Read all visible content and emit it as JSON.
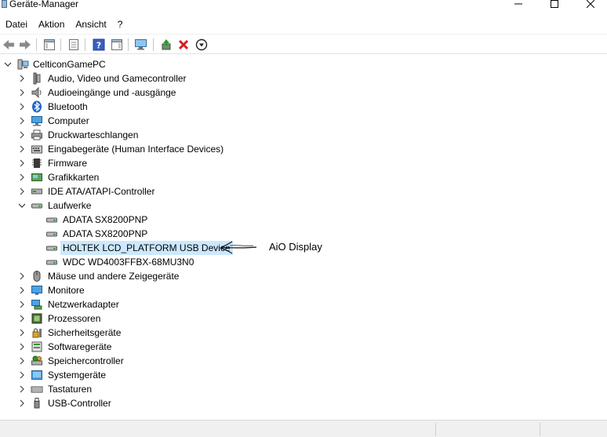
{
  "window": {
    "title": "Geräte-Manager",
    "icon": "device-manager-icon"
  },
  "menu": [
    "Datei",
    "Aktion",
    "Ansicht",
    "?"
  ],
  "toolbar": [
    {
      "name": "back-icon"
    },
    {
      "name": "forward-icon"
    },
    {
      "name": "show-hide-console-tree-icon"
    },
    {
      "name": "properties-icon"
    },
    {
      "name": "help-icon"
    },
    {
      "name": "action-pane-icon"
    },
    {
      "name": "scan-hardware-icon"
    },
    {
      "name": "update-driver-icon"
    },
    {
      "name": "uninstall-device-icon"
    },
    {
      "name": "disable-device-icon"
    }
  ],
  "tree": {
    "root": "CelticonGamePC",
    "categories": [
      {
        "label": "Audio, Video und Gamecontroller",
        "icon": "audio-icon"
      },
      {
        "label": "Audioeingänge und -ausgänge",
        "icon": "speaker-icon"
      },
      {
        "label": "Bluetooth",
        "icon": "bluetooth-icon"
      },
      {
        "label": "Computer",
        "icon": "computer-icon"
      },
      {
        "label": "Druckwarteschlangen",
        "icon": "printer-icon"
      },
      {
        "label": "Eingabegeräte (Human Interface Devices)",
        "icon": "hid-icon"
      },
      {
        "label": "Firmware",
        "icon": "firmware-icon"
      },
      {
        "label": "Grafikkarten",
        "icon": "display-adapter-icon"
      },
      {
        "label": "IDE ATA/ATAPI-Controller",
        "icon": "ide-controller-icon"
      },
      {
        "label": "Laufwerke",
        "icon": "disk-drive-icon",
        "expanded": true
      },
      {
        "label": "Mäuse und andere Zeigegeräte",
        "icon": "mouse-icon"
      },
      {
        "label": "Monitore",
        "icon": "monitor-icon"
      },
      {
        "label": "Netzwerkadapter",
        "icon": "network-adapter-icon"
      },
      {
        "label": "Prozessoren",
        "icon": "processor-icon"
      },
      {
        "label": "Sicherheitsgeräte",
        "icon": "security-device-icon"
      },
      {
        "label": "Softwaregeräte",
        "icon": "software-device-icon"
      },
      {
        "label": "Speichercontroller",
        "icon": "storage-controller-icon"
      },
      {
        "label": "Systemgeräte",
        "icon": "system-device-icon"
      },
      {
        "label": "Tastaturen",
        "icon": "keyboard-icon"
      },
      {
        "label": "USB-Controller",
        "icon": "usb-icon"
      }
    ],
    "drives": [
      "ADATA SX8200PNP",
      "ADATA SX8200PNP",
      "HOLTEK LCD_PLATFORM USB Device",
      "WDC WD4003FFBX-68MU3N0"
    ],
    "selected_drive_index": 2
  },
  "annotation": {
    "text": "AiO Display"
  }
}
